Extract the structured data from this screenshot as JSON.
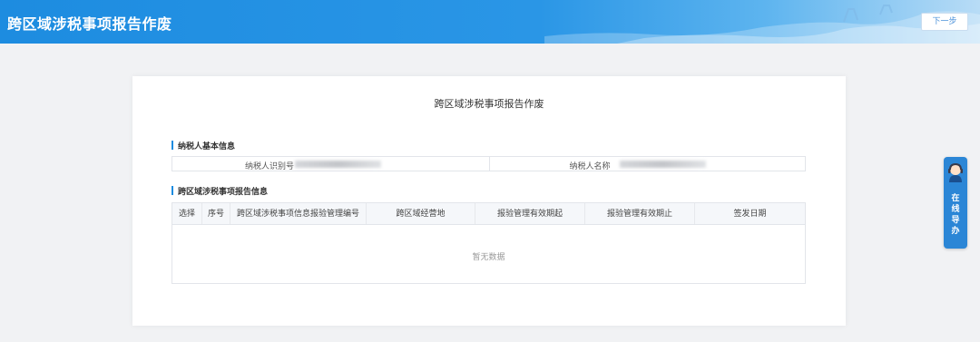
{
  "header": {
    "title": "跨区域涉税事项报告作废",
    "next_button": "下一步"
  },
  "card": {
    "title": "跨区域涉税事项报告作废"
  },
  "taxpayer_section": {
    "heading": "纳税人基本信息",
    "id_label": "纳税人识别号",
    "name_label": "纳税人名称"
  },
  "report_section": {
    "heading": "跨区域涉税事项报告信息",
    "columns": [
      "选择",
      "序号",
      "跨区域涉税事项信息报验管理编号",
      "跨区域经营地",
      "报验管理有效期起",
      "报验管理有效期止",
      "签发日期"
    ],
    "empty_text": "暂无数据"
  },
  "online_guide": {
    "label": "在线导办"
  },
  "colors": {
    "brand_blue": "#1d8ce0",
    "page_bg": "#f1f2f4"
  }
}
